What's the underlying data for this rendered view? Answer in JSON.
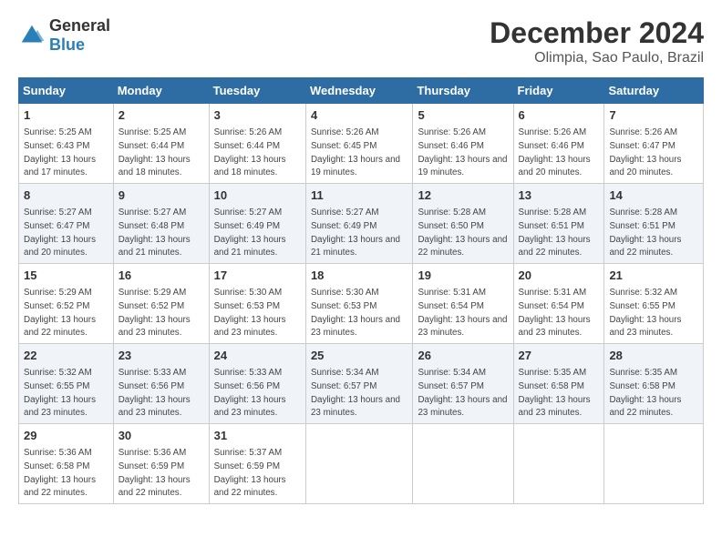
{
  "logo": {
    "general": "General",
    "blue": "Blue"
  },
  "title": "December 2024",
  "subtitle": "Olimpia, Sao Paulo, Brazil",
  "days_of_week": [
    "Sunday",
    "Monday",
    "Tuesday",
    "Wednesday",
    "Thursday",
    "Friday",
    "Saturday"
  ],
  "weeks": [
    [
      {
        "day": 1,
        "sunrise": "5:25 AM",
        "sunset": "6:43 PM",
        "daylight": "13 hours and 17 minutes."
      },
      {
        "day": 2,
        "sunrise": "5:25 AM",
        "sunset": "6:44 PM",
        "daylight": "13 hours and 18 minutes."
      },
      {
        "day": 3,
        "sunrise": "5:26 AM",
        "sunset": "6:44 PM",
        "daylight": "13 hours and 18 minutes."
      },
      {
        "day": 4,
        "sunrise": "5:26 AM",
        "sunset": "6:45 PM",
        "daylight": "13 hours and 19 minutes."
      },
      {
        "day": 5,
        "sunrise": "5:26 AM",
        "sunset": "6:46 PM",
        "daylight": "13 hours and 19 minutes."
      },
      {
        "day": 6,
        "sunrise": "5:26 AM",
        "sunset": "6:46 PM",
        "daylight": "13 hours and 20 minutes."
      },
      {
        "day": 7,
        "sunrise": "5:26 AM",
        "sunset": "6:47 PM",
        "daylight": "13 hours and 20 minutes."
      }
    ],
    [
      {
        "day": 8,
        "sunrise": "5:27 AM",
        "sunset": "6:47 PM",
        "daylight": "13 hours and 20 minutes."
      },
      {
        "day": 9,
        "sunrise": "5:27 AM",
        "sunset": "6:48 PM",
        "daylight": "13 hours and 21 minutes."
      },
      {
        "day": 10,
        "sunrise": "5:27 AM",
        "sunset": "6:49 PM",
        "daylight": "13 hours and 21 minutes."
      },
      {
        "day": 11,
        "sunrise": "5:27 AM",
        "sunset": "6:49 PM",
        "daylight": "13 hours and 21 minutes."
      },
      {
        "day": 12,
        "sunrise": "5:28 AM",
        "sunset": "6:50 PM",
        "daylight": "13 hours and 22 minutes."
      },
      {
        "day": 13,
        "sunrise": "5:28 AM",
        "sunset": "6:51 PM",
        "daylight": "13 hours and 22 minutes."
      },
      {
        "day": 14,
        "sunrise": "5:28 AM",
        "sunset": "6:51 PM",
        "daylight": "13 hours and 22 minutes."
      }
    ],
    [
      {
        "day": 15,
        "sunrise": "5:29 AM",
        "sunset": "6:52 PM",
        "daylight": "13 hours and 22 minutes."
      },
      {
        "day": 16,
        "sunrise": "5:29 AM",
        "sunset": "6:52 PM",
        "daylight": "13 hours and 23 minutes."
      },
      {
        "day": 17,
        "sunrise": "5:30 AM",
        "sunset": "6:53 PM",
        "daylight": "13 hours and 23 minutes."
      },
      {
        "day": 18,
        "sunrise": "5:30 AM",
        "sunset": "6:53 PM",
        "daylight": "13 hours and 23 minutes."
      },
      {
        "day": 19,
        "sunrise": "5:31 AM",
        "sunset": "6:54 PM",
        "daylight": "13 hours and 23 minutes."
      },
      {
        "day": 20,
        "sunrise": "5:31 AM",
        "sunset": "6:54 PM",
        "daylight": "13 hours and 23 minutes."
      },
      {
        "day": 21,
        "sunrise": "5:32 AM",
        "sunset": "6:55 PM",
        "daylight": "13 hours and 23 minutes."
      }
    ],
    [
      {
        "day": 22,
        "sunrise": "5:32 AM",
        "sunset": "6:55 PM",
        "daylight": "13 hours and 23 minutes."
      },
      {
        "day": 23,
        "sunrise": "5:33 AM",
        "sunset": "6:56 PM",
        "daylight": "13 hours and 23 minutes."
      },
      {
        "day": 24,
        "sunrise": "5:33 AM",
        "sunset": "6:56 PM",
        "daylight": "13 hours and 23 minutes."
      },
      {
        "day": 25,
        "sunrise": "5:34 AM",
        "sunset": "6:57 PM",
        "daylight": "13 hours and 23 minutes."
      },
      {
        "day": 26,
        "sunrise": "5:34 AM",
        "sunset": "6:57 PM",
        "daylight": "13 hours and 23 minutes."
      },
      {
        "day": 27,
        "sunrise": "5:35 AM",
        "sunset": "6:58 PM",
        "daylight": "13 hours and 23 minutes."
      },
      {
        "day": 28,
        "sunrise": "5:35 AM",
        "sunset": "6:58 PM",
        "daylight": "13 hours and 22 minutes."
      }
    ],
    [
      {
        "day": 29,
        "sunrise": "5:36 AM",
        "sunset": "6:58 PM",
        "daylight": "13 hours and 22 minutes."
      },
      {
        "day": 30,
        "sunrise": "5:36 AM",
        "sunset": "6:59 PM",
        "daylight": "13 hours and 22 minutes."
      },
      {
        "day": 31,
        "sunrise": "5:37 AM",
        "sunset": "6:59 PM",
        "daylight": "13 hours and 22 minutes."
      },
      null,
      null,
      null,
      null
    ]
  ]
}
